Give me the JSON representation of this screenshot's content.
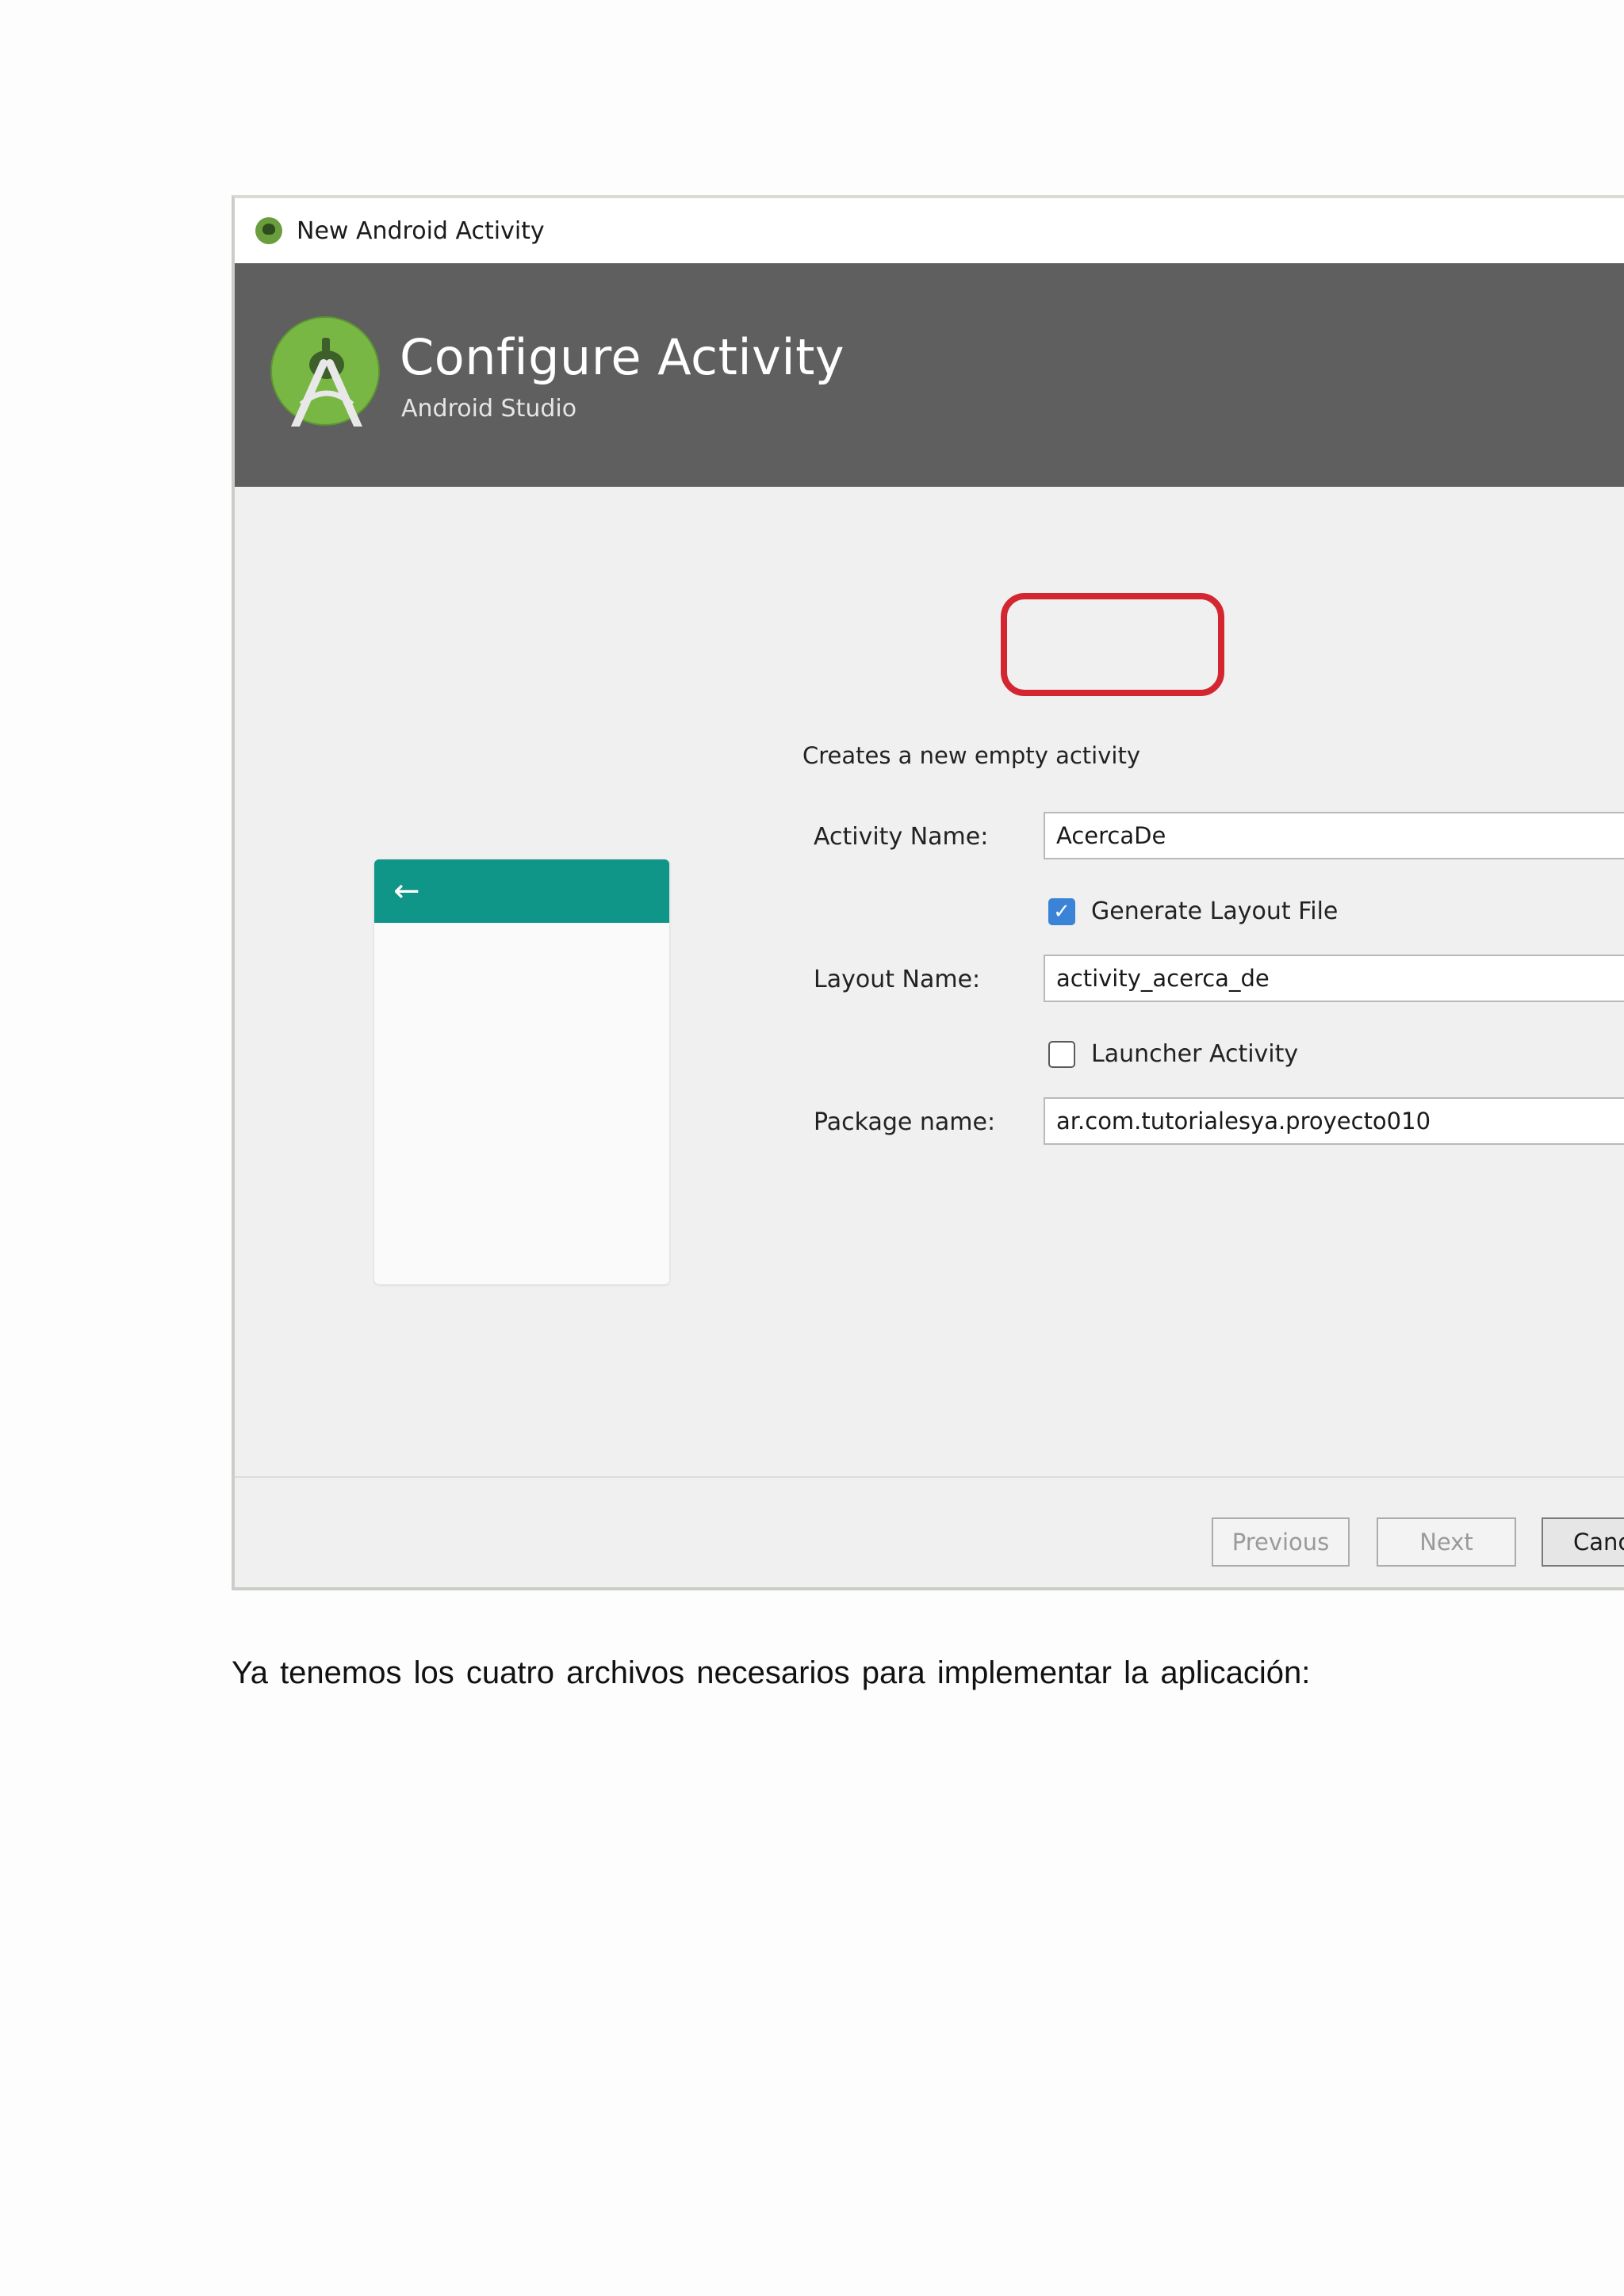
{
  "window": {
    "title": "New Android Activity",
    "banner_title": "Configure Activity",
    "banner_subtitle": "Android Studio"
  },
  "form": {
    "description": "Creates a new empty activity",
    "activity_name_label": "Activity Name:",
    "activity_name_value": "AcercaDe",
    "generate_layout_label": "Generate Layout File",
    "generate_layout_checked": true,
    "layout_name_label": "Layout Name:",
    "layout_name_value": "activity_acerca_de",
    "launcher_activity_label": "Launcher Activity",
    "launcher_activity_checked": false,
    "package_name_label": "Package name:",
    "package_name_value": "ar.com.tutorialesya.proyecto010"
  },
  "preview": {
    "back_icon": "arrow-left-icon"
  },
  "footer": {
    "previous_label": "Previous",
    "next_label": "Next",
    "cancel_label": "Canc"
  },
  "document": {
    "paragraph": "Ya tenemos los cuatro archivos necesarios para implementar la aplicación:"
  },
  "colors": {
    "banner": "#5f5f5f",
    "preview_appbar": "#0f9688",
    "highlight": "#d32630",
    "checkbox_checked": "#3a83d6"
  }
}
